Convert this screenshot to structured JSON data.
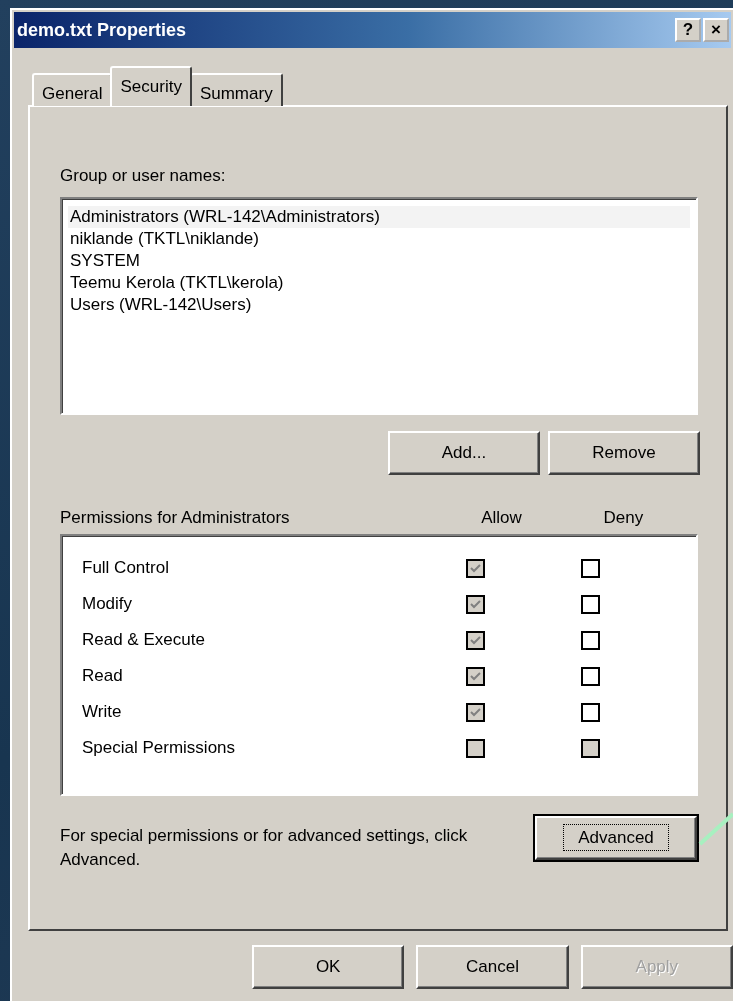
{
  "window": {
    "title": "demo.txt Properties",
    "title_buttons": [
      "?",
      "×"
    ]
  },
  "tabs": [
    {
      "label": "General",
      "selected": false
    },
    {
      "label": "Security",
      "selected": true
    },
    {
      "label": "Summary",
      "selected": false
    }
  ],
  "group_list": {
    "label": "Group or user names:",
    "items": [
      {
        "label": "Administrators (WRL-142\\Administrators)",
        "selected": true
      },
      {
        "label": "niklande (TKTL\\niklande)",
        "selected": false
      },
      {
        "label": "SYSTEM",
        "selected": false
      },
      {
        "label": "Teemu Kerola (TKTL\\kerola)",
        "selected": false
      },
      {
        "label": "Users (WRL-142\\Users)",
        "selected": false
      }
    ]
  },
  "group_buttons": [
    {
      "label": "Add...",
      "disabled": false,
      "focused": false
    },
    {
      "label": "Remove",
      "disabled": false,
      "focused": false
    }
  ],
  "permissions": {
    "label": "Permissions for Administrators",
    "columns": [
      "Allow",
      "Deny"
    ],
    "rows": [
      {
        "name": "Full Control",
        "allow": {
          "checked": true,
          "disabled": true
        },
        "deny": {
          "checked": false,
          "disabled": false
        }
      },
      {
        "name": "Modify",
        "allow": {
          "checked": true,
          "disabled": true
        },
        "deny": {
          "checked": false,
          "disabled": false
        }
      },
      {
        "name": "Read & Execute",
        "allow": {
          "checked": true,
          "disabled": true
        },
        "deny": {
          "checked": false,
          "disabled": false
        }
      },
      {
        "name": "Read",
        "allow": {
          "checked": true,
          "disabled": true
        },
        "deny": {
          "checked": false,
          "disabled": false
        }
      },
      {
        "name": "Write",
        "allow": {
          "checked": true,
          "disabled": true
        },
        "deny": {
          "checked": false,
          "disabled": false
        }
      },
      {
        "name": "Special Permissions",
        "allow": {
          "checked": false,
          "disabled": true
        },
        "deny": {
          "checked": false,
          "disabled": true
        }
      }
    ]
  },
  "advanced": {
    "text": "For special permissions or for advanced settings, click Advanced.",
    "button": {
      "label": "Advanced",
      "disabled": false,
      "focused": true
    }
  },
  "dialog_buttons": [
    {
      "label": "OK",
      "disabled": false,
      "focused": false
    },
    {
      "label": "Cancel",
      "disabled": false,
      "focused": false
    },
    {
      "label": "Apply",
      "disabled": true,
      "focused": false
    }
  ]
}
